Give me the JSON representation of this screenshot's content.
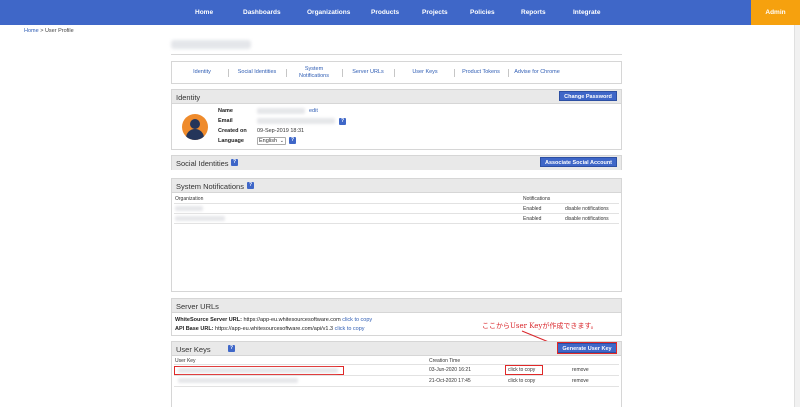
{
  "nav": {
    "items": [
      "Home",
      "Dashboards",
      "Organizations",
      "Products",
      "Projects",
      "Policies",
      "Reports",
      "Integrate"
    ],
    "admin": "Admin"
  },
  "breadcrumb": {
    "home": "Home",
    "sep": " > ",
    "current": "User Profile"
  },
  "tabs": [
    "Identity",
    "Social Identities",
    "System\nNotifications",
    "Server URLs",
    "User Keys",
    "Product Tokens",
    "Advise for Chrome"
  ],
  "identity": {
    "title": "Identity",
    "change_password": "Change Password",
    "labels": {
      "name": "Name",
      "email": "Email",
      "created_on": "Created on",
      "language": "Language"
    },
    "edit": "edit",
    "created_on": "09-Sep-2019 18:31",
    "language": "English",
    "help_glyph": "?"
  },
  "social": {
    "title": "Social Identities",
    "button": "Associate Social Account",
    "help_glyph": "?"
  },
  "notifications": {
    "title": "System Notifications",
    "help_glyph": "?",
    "headers": {
      "organization": "Organization",
      "notifications": "Notifications"
    },
    "rows": [
      {
        "status": "Enabled",
        "action": "disable notifications"
      },
      {
        "status": "Enabled",
        "action": "disable notifications"
      }
    ]
  },
  "server_urls": {
    "title": "Server URLs",
    "server_label": "WhiteSource Server URL:",
    "server_value": "https://app-eu.whitesourcesoftware.com",
    "api_label": "API Base URL:",
    "api_value": "https://app-eu.whitesourcesoftware.com/api/v1.3",
    "copy": "click to copy"
  },
  "user_keys": {
    "title": "User Keys",
    "help_glyph": "?",
    "button": "Generate User Key",
    "headers": {
      "key": "User Key",
      "created": "Creation Time"
    },
    "rows": [
      {
        "created": "03-Jun-2020 16:21",
        "copy": "click to copy",
        "remove": "remove"
      },
      {
        "created": "21-Oct-2020 17:45",
        "copy": "click to copy",
        "remove": "remove"
      }
    ]
  },
  "annotation": "ここからUser Keyが作成できます。",
  "colors": {
    "nav": "#3f67c8",
    "admin": "#f6a10e",
    "annotation": "#d9262b"
  }
}
